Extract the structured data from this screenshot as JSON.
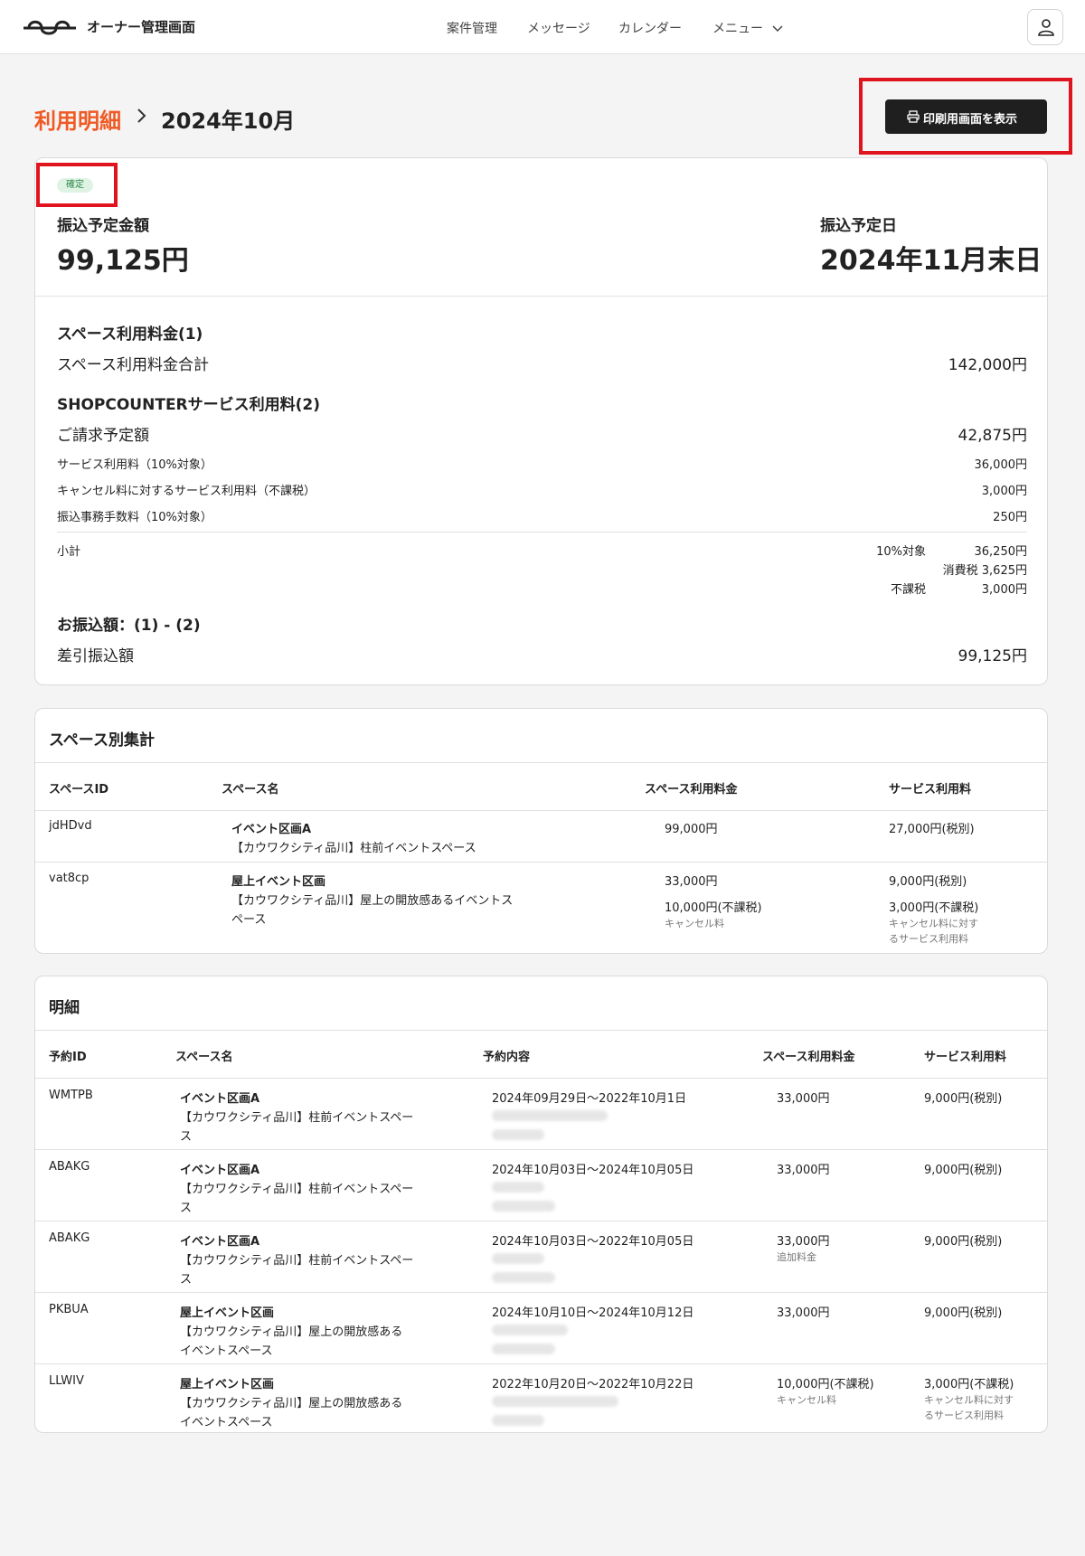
{
  "header": {
    "brand": "オーナー管理画面",
    "nav": {
      "cases": "案件管理",
      "messages": "メッセージ",
      "calendar": "カレンダー",
      "menu": "メニュー"
    }
  },
  "breadcrumb": {
    "parent": "利用明細",
    "current": "2024年10月"
  },
  "print_button": "印刷用画面を表示",
  "summary": {
    "status": "確定",
    "amount_label": "振込予定金額",
    "amount": "99,125円",
    "date_label": "振込予定日",
    "date": "2024年11月末日",
    "section1_title": "スペース利用料金(1)",
    "space_total_label": "スペース利用料金合計",
    "space_total": "142,000円",
    "section2_title": "SHOPCOUNTERサービス利用料(2)",
    "billing_label": "ご請求予定額",
    "billing": "42,875円",
    "fees": [
      {
        "label": "サービス利用料（10%対象）",
        "value": "36,000円"
      },
      {
        "label": "キャンセル料に対するサービス利用料（不課税）",
        "value": "3,000円"
      },
      {
        "label": "振込事務手数料（10%対象）",
        "value": "250円"
      }
    ],
    "subtotal_label": "小計",
    "subtotal": {
      "taxable_label": "10%対象",
      "taxable": "36,250円",
      "tax": "消費税 3,625円",
      "nontax_label": "不課税",
      "nontax": "3,000円"
    },
    "section3_title": "お振込額：(1) - (2)",
    "net_label": "差引振込額",
    "net": "99,125円"
  },
  "by_space": {
    "title": "スペース別集計",
    "headers": [
      "スペースID",
      "スペース名",
      "スペース利用料金",
      "サービス利用料"
    ],
    "rows": [
      {
        "id": "jdHDvd",
        "name": "イベント区画A",
        "place": "【カウワクシティ品川】柱前イベントスペース",
        "place2": "",
        "fee": "99,000円",
        "fee2": "",
        "fee2_note": "",
        "svc": "27,000円(税別)",
        "svc2": "",
        "svc2_note1": "",
        "svc2_note2": ""
      },
      {
        "id": "vat8cp",
        "name": "屋上イベント区画",
        "place": "【カウワクシティ品川】屋上の開放感あるイベントス",
        "place2": "ペース",
        "fee": "33,000円",
        "fee2": "10,000円(不課税)",
        "fee2_note": "キャンセル料",
        "svc": "9,000円(税別)",
        "svc2": "3,000円(不課税)",
        "svc2_note1": "キャンセル料に対す",
        "svc2_note2": "るサービス利用料"
      }
    ]
  },
  "detail": {
    "title": "明細",
    "headers": [
      "予約ID",
      "スペース名",
      "予約内容",
      "スペース利用料金",
      "サービス利用料"
    ],
    "rows": [
      {
        "id": "WMTPB",
        "name": "イベント区画A",
        "place": "【カウワクシティ品川】柱前イベントスペー",
        "place2": "ス",
        "period": "2024年09月29日〜2022年10月1日",
        "fee": "33,000円",
        "fee_note": "",
        "svc": "9,000円(税別)",
        "svc_note1": "",
        "svc_note2": ""
      },
      {
        "id": "ABAKG",
        "name": "イベント区画A",
        "place": "【カウワクシティ品川】柱前イベントスペー",
        "place2": "ス",
        "period": "2024年10月03日〜2024年10月05日",
        "fee": "33,000円",
        "fee_note": "",
        "svc": "9,000円(税別)",
        "svc_note1": "",
        "svc_note2": ""
      },
      {
        "id": "ABAKG",
        "name": "イベント区画A",
        "place": "【カウワクシティ品川】柱前イベントスペー",
        "place2": "ス",
        "period": "2024年10月03日〜2022年10月05日",
        "fee": "33,000円",
        "fee_note": "追加料金",
        "svc": "9,000円(税別)",
        "svc_note1": "",
        "svc_note2": ""
      },
      {
        "id": "PKBUA",
        "name": "屋上イベント区画",
        "place": "【カウワクシティ品川】屋上の開放感ある",
        "place2": "イベントスペース",
        "period": "2024年10月10日〜2024年10月12日",
        "fee": "33,000円",
        "fee_note": "",
        "svc": "9,000円(税別)",
        "svc_note1": "",
        "svc_note2": ""
      },
      {
        "id": "LLWIV",
        "name": "屋上イベント区画",
        "place": "【カウワクシティ品川】屋上の開放感ある",
        "place2": "イベントスペース",
        "period": "2022年10月20日〜2022年10月22日",
        "fee": "10,000円(不課税)",
        "fee_note": "キャンセル料",
        "svc": "3,000円(不課税)",
        "svc_note1": "キャンセル料に対す",
        "svc_note2": "るサービス利用料"
      }
    ]
  },
  "colors": {
    "accent": "#ef5a24",
    "highlight": "#e0141e",
    "badge_bg": "#dff3e4",
    "button_bg": "#1f1f1f"
  }
}
